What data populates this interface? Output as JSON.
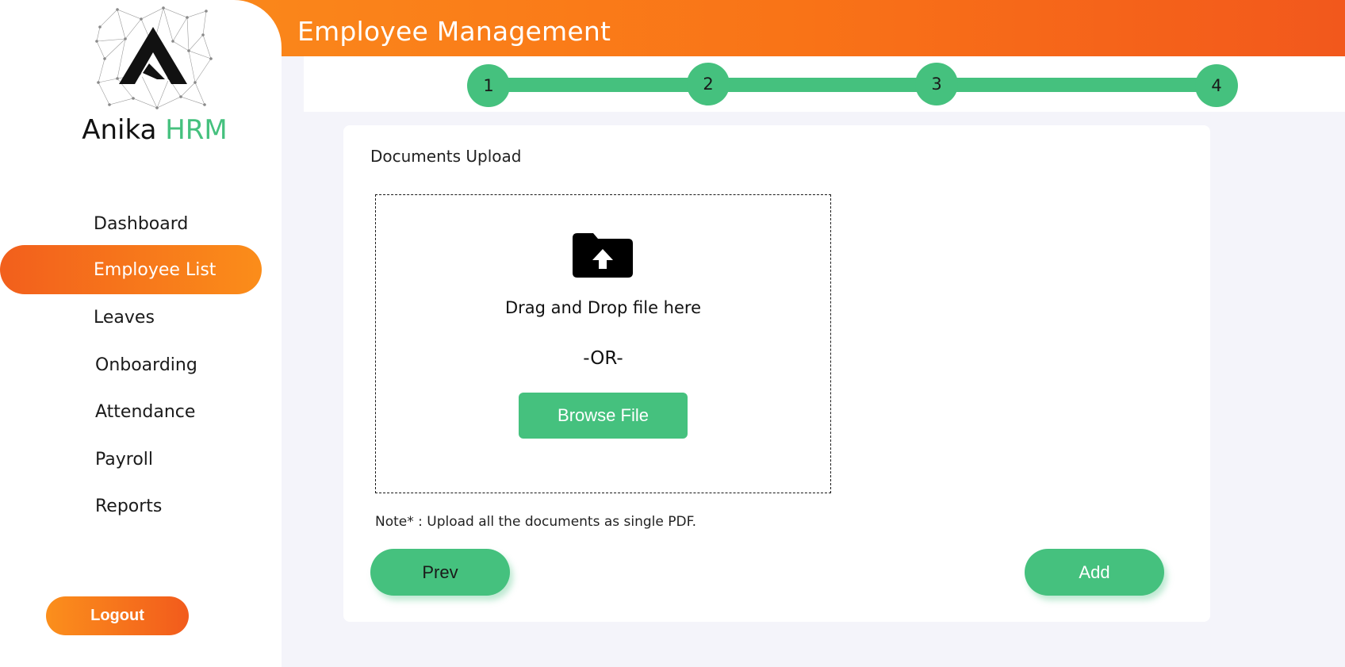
{
  "header": {
    "title": "Employee Management"
  },
  "brand": {
    "name": "Anika",
    "accent": "HRM"
  },
  "sidebar": {
    "items": [
      {
        "label": "Dashboard",
        "active": false
      },
      {
        "label": "Employee List",
        "active": true
      },
      {
        "label": "Leaves",
        "active": false
      },
      {
        "label": "Onboarding",
        "active": false
      },
      {
        "label": "Attendance",
        "active": false
      },
      {
        "label": "Payroll",
        "active": false
      },
      {
        "label": "Reports",
        "active": false
      }
    ],
    "logout_label": "Logout"
  },
  "stepper": {
    "steps": [
      "1",
      "2",
      "3",
      "4"
    ],
    "current": 4
  },
  "upload": {
    "title": "Documents Upload",
    "drag_text": "Drag and Drop file here",
    "or_text": "-OR-",
    "browse_label": "Browse File",
    "icon": "folder-upload-icon",
    "note": "Note* : Upload all the documents as single PDF."
  },
  "actions": {
    "prev_label": "Prev",
    "add_label": "Add"
  },
  "colors": {
    "accent_green": "#45c17e",
    "header_orange": "#f97317",
    "active_orange_start": "#f25f1c",
    "active_orange_end": "#fb8d1a"
  }
}
